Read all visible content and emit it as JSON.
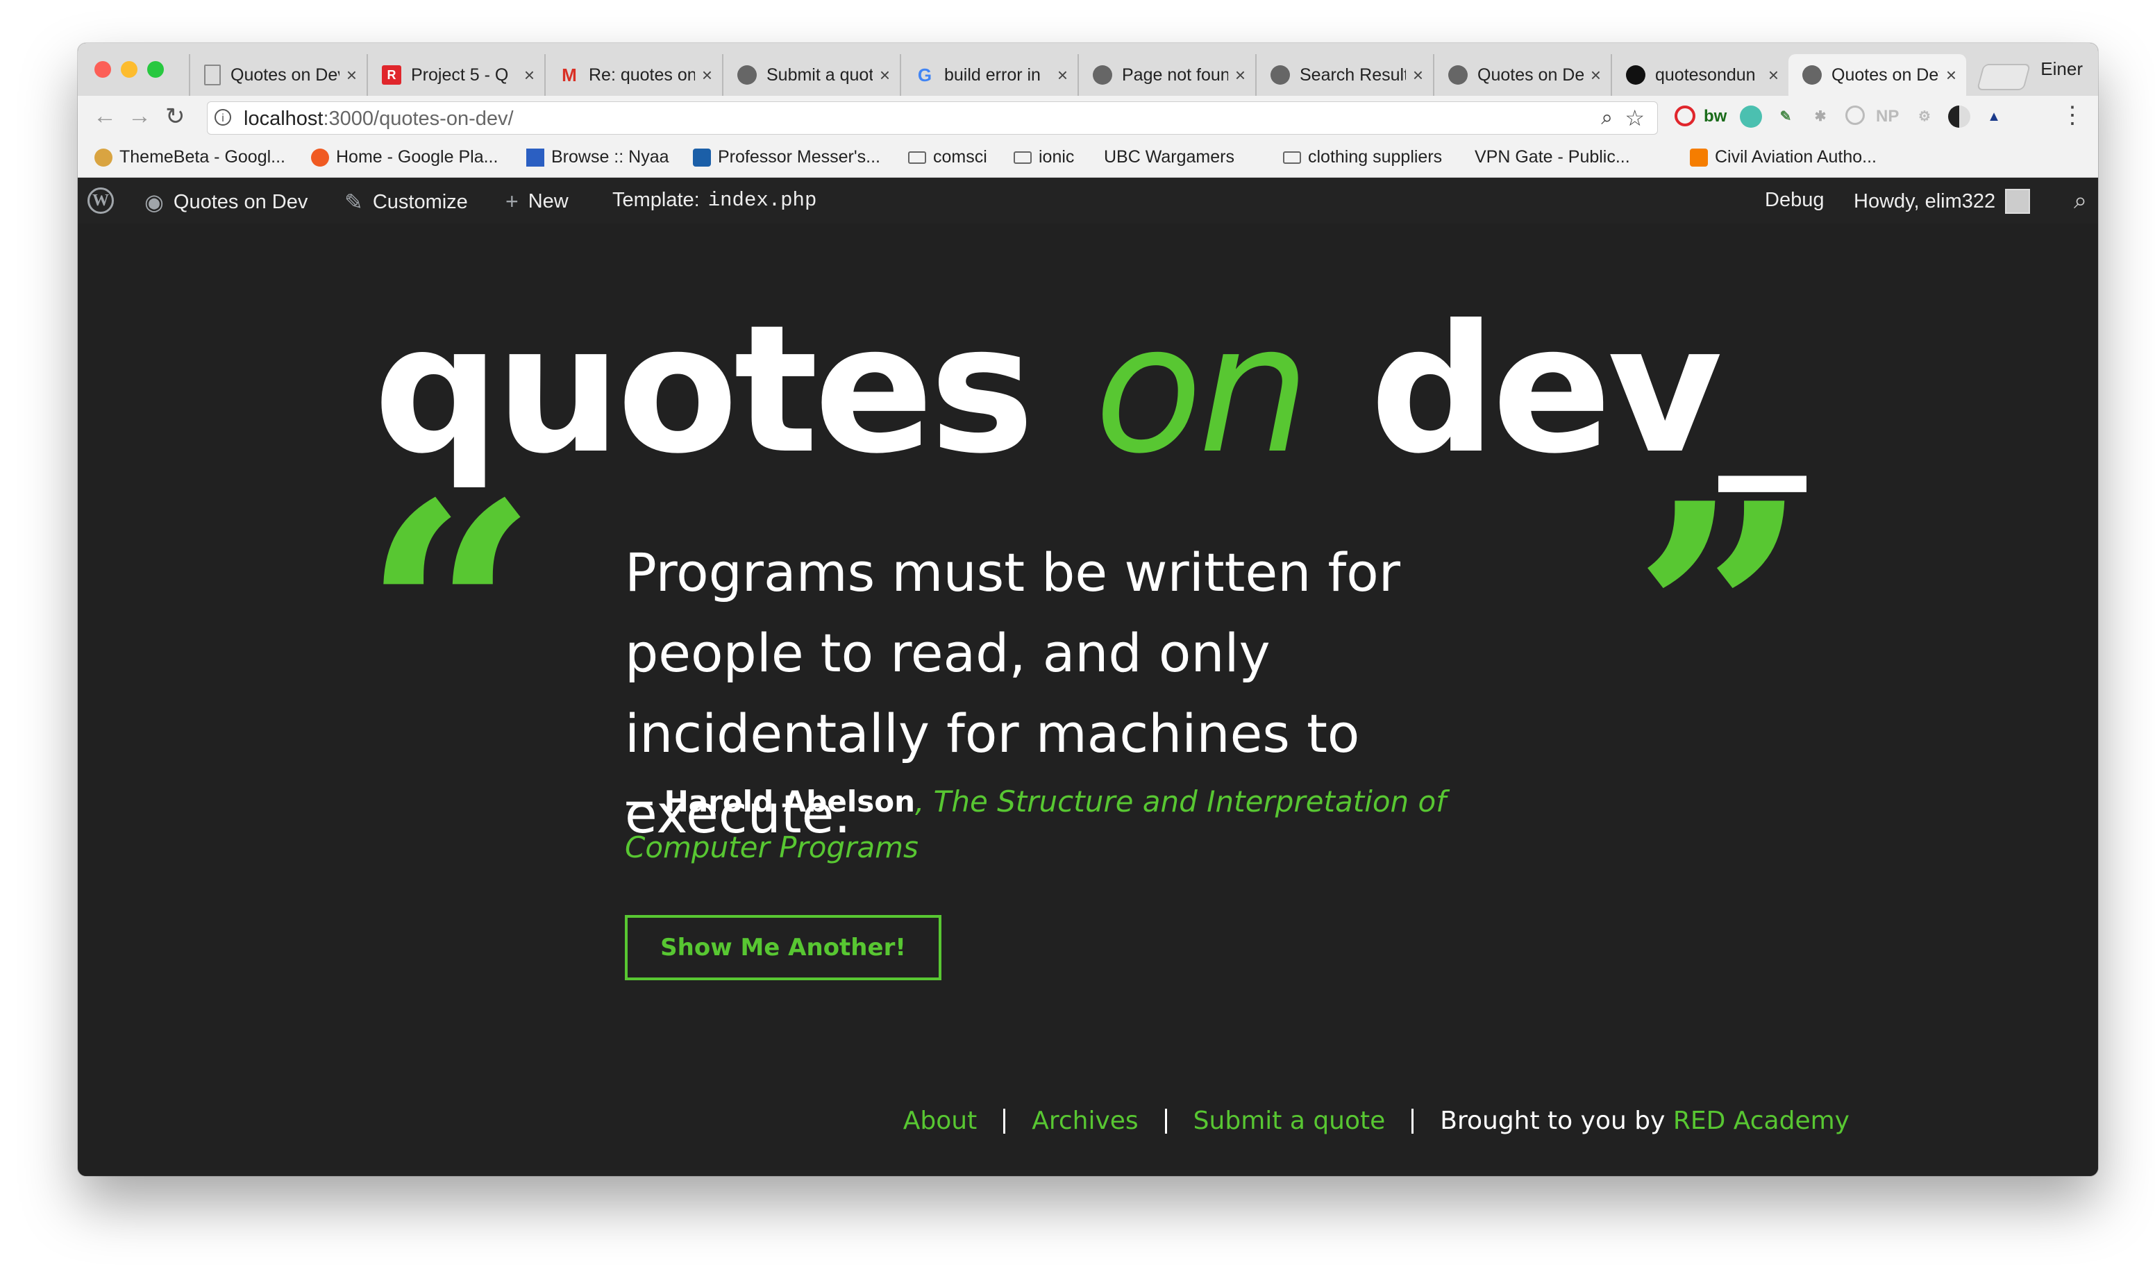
{
  "colors": {
    "accent": "#58c732",
    "page_bg": "#212121",
    "admin_bar_bg": "#232323"
  },
  "browser": {
    "tabs": [
      {
        "title": "Quotes on Dev",
        "icon": "page-icon"
      },
      {
        "title": "Project 5 - Q",
        "icon": "r-logo-icon"
      },
      {
        "title": "Re: quotes on",
        "icon": "gmail-icon"
      },
      {
        "title": "Submit a quote",
        "icon": "github-octocat-icon"
      },
      {
        "title": "build error in",
        "icon": "google-icon"
      },
      {
        "title": "Page not found",
        "icon": "github-octocat-icon"
      },
      {
        "title": "Search Results",
        "icon": "github-octocat-icon"
      },
      {
        "title": "Quotes on Dev",
        "icon": "github-octocat-icon"
      },
      {
        "title": "quotesondun",
        "icon": "github-icon"
      },
      {
        "title": "Quotes on Dev",
        "icon": "github-octocat-icon",
        "active": true
      }
    ],
    "profile_label": "Einer",
    "url_host": "localhost",
    "url_path": ":3000/quotes-on-dev/",
    "bookmarks": [
      {
        "label": "ThemeBeta - Googl...",
        "icon": "themebeta-icon"
      },
      {
        "label": "Home - Google Pla...",
        "icon": "google-play-icon"
      },
      {
        "label": "Browse :: Nyaa",
        "icon": "nyaa-icon"
      },
      {
        "label": "Professor Messer's...",
        "icon": "messer-icon"
      },
      {
        "label": "comsci",
        "icon": "folder-icon"
      },
      {
        "label": "ionic",
        "icon": "folder-icon"
      },
      {
        "label": "UBC Wargamers",
        "icon": "page-icon"
      },
      {
        "label": "clothing suppliers",
        "icon": "folder-icon"
      },
      {
        "label": "VPN Gate - Public...",
        "icon": "page-icon"
      },
      {
        "label": "Civil Aviation Autho...",
        "icon": "blogger-icon"
      }
    ]
  },
  "admin_bar": {
    "site_name": "Quotes on Dev",
    "customize": "Customize",
    "new": "New",
    "template_label": "Template:",
    "template_file": "index.php",
    "debug": "Debug",
    "howdy": "Howdy, elim322"
  },
  "site": {
    "title_part1": "quotes",
    "title_part2": "on",
    "title_part3": "dev_"
  },
  "quote": {
    "open_mark": "“",
    "close_mark": "”",
    "text": "Programs must be written for people to read, and only incidentally for machines to execute.",
    "author": "— Harold Abelson",
    "source": ", The Structure and Interpretation of Computer Programs"
  },
  "cta": {
    "label": "Show Me Another!"
  },
  "footer": {
    "links": [
      "About",
      "Archives",
      "Submit a quote"
    ],
    "credit_prefix": "Brought to you by",
    "credit_link": "RED Academy"
  }
}
